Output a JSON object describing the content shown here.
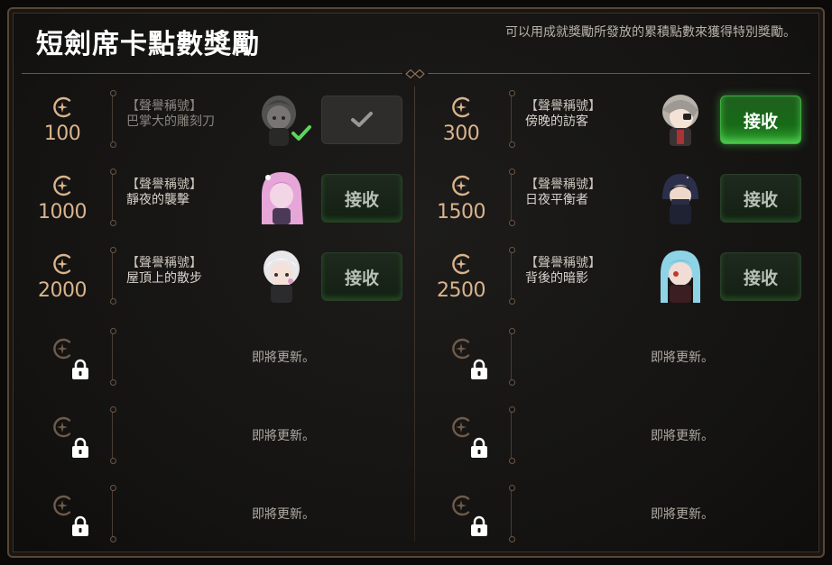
{
  "header": {
    "title": "短劍席卡點數獎勵",
    "description": "可以用成就獎勵所發放的累積點數來獲得特別獎勵。"
  },
  "colors": {
    "accent_gold": "#d9b48c",
    "button_green": "#2fa02f",
    "frame_border": "#5a4636"
  },
  "left_column": [
    {
      "points": "100",
      "reward_type": "【聲譽稱號】",
      "reward_name": "巴掌大的雕刻刀",
      "status": "claimed",
      "button_icon": "checkmark-icon",
      "avatar": "gray-hair-character-avatar"
    },
    {
      "points": "1000",
      "reward_type": "【聲譽稱號】",
      "reward_name": "靜夜的襲擊",
      "status": "available",
      "button_label": "接收",
      "avatar": "pink-hair-character-avatar"
    },
    {
      "points": "2000",
      "reward_type": "【聲譽稱號】",
      "reward_name": "屋頂上的散步",
      "status": "available",
      "button_label": "接收",
      "avatar": "white-hair-character-avatar"
    },
    {
      "status": "locked",
      "locked_text": "即將更新。"
    },
    {
      "status": "locked",
      "locked_text": "即將更新。"
    },
    {
      "status": "locked",
      "locked_text": "即將更新。"
    }
  ],
  "right_column": [
    {
      "points": "300",
      "reward_type": "【聲譽稱號】",
      "reward_name": "傍晚的訪客",
      "status": "highlighted",
      "button_label": "接收",
      "avatar": "eyepatch-character-avatar"
    },
    {
      "points": "1500",
      "reward_type": "【聲譽稱號】",
      "reward_name": "日夜平衡者",
      "status": "available",
      "button_label": "接收",
      "avatar": "hooded-character-avatar"
    },
    {
      "points": "2500",
      "reward_type": "【聲譽稱號】",
      "reward_name": "背後的暗影",
      "status": "available",
      "button_label": "接收",
      "avatar": "blue-hair-character-avatar"
    },
    {
      "status": "locked",
      "locked_text": "即將更新。"
    },
    {
      "status": "locked",
      "locked_text": "即將更新。"
    },
    {
      "status": "locked",
      "locked_text": "即將更新。"
    }
  ]
}
